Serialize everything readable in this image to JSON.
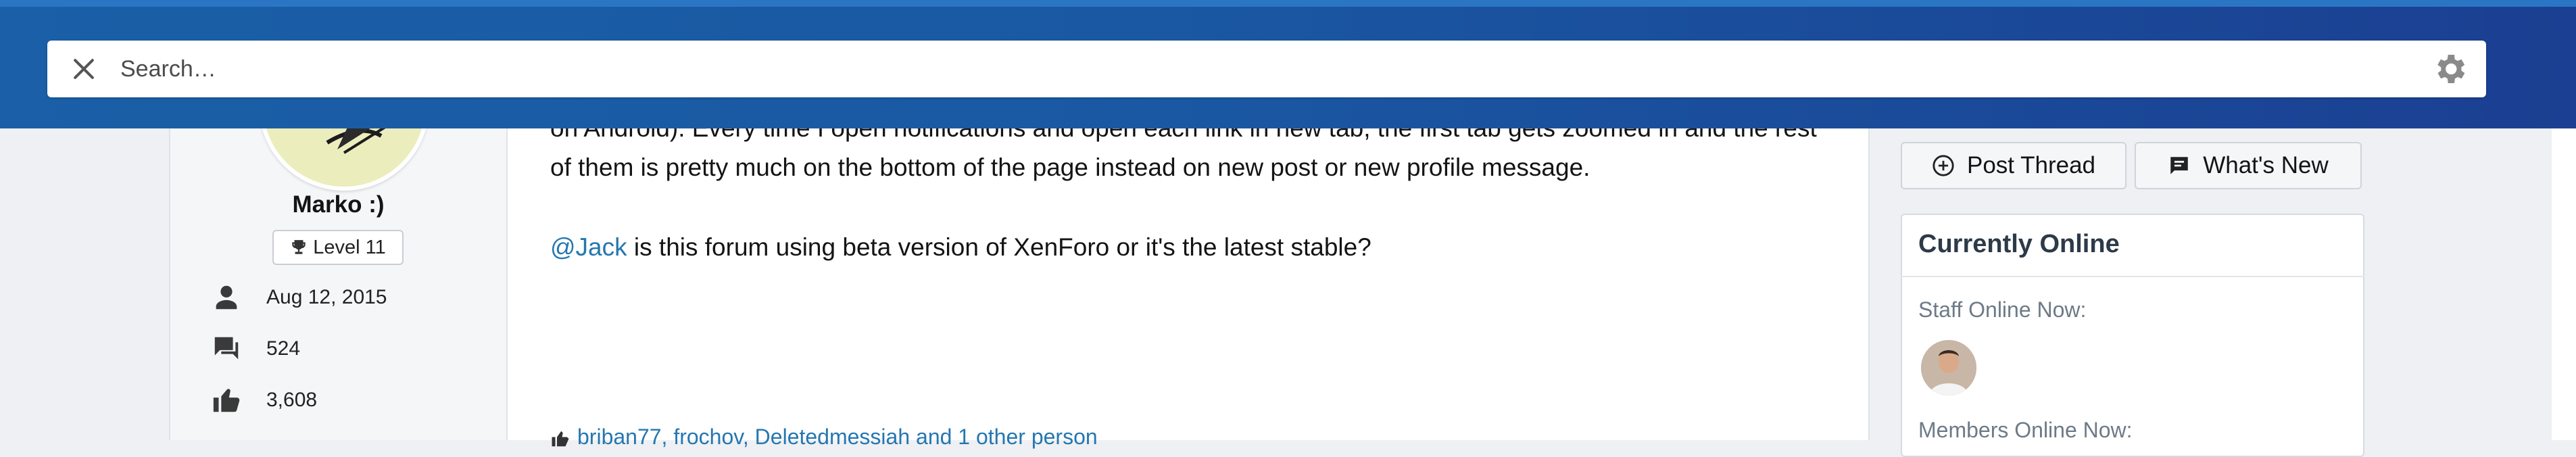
{
  "search": {
    "placeholder": "Search…",
    "value": ""
  },
  "post": {
    "lines": [
      "on Android). Every time I open notifications and open each link in new tab, the first tab gets zoomed in and the rest",
      "of them is pretty much on the bottom of the page instead on new post or new profile message."
    ],
    "mention": "@Jack",
    "mention_text": " is this forum using beta version of XenForo or it's the latest stable?",
    "reactions": "briban77, frochov, Deletedmessiah and 1 other person"
  },
  "user": {
    "name": "Marko :)",
    "level": "Level 11",
    "joined": "Aug 12, 2015",
    "messages": "524",
    "reactions": "3,608"
  },
  "sidebar": {
    "post_thread": "Post Thread",
    "whats_new": "What's New",
    "online_title": "Currently Online",
    "staff_label": "Staff Online Now:",
    "members_label": "Members Online Now:"
  },
  "icons": [
    "close-icon",
    "gear-icon",
    "user-icon",
    "messages-icon",
    "thumbs-up-icon",
    "trophy-icon",
    "plus-circle-icon",
    "comment-icon",
    "reaction-icon"
  ]
}
